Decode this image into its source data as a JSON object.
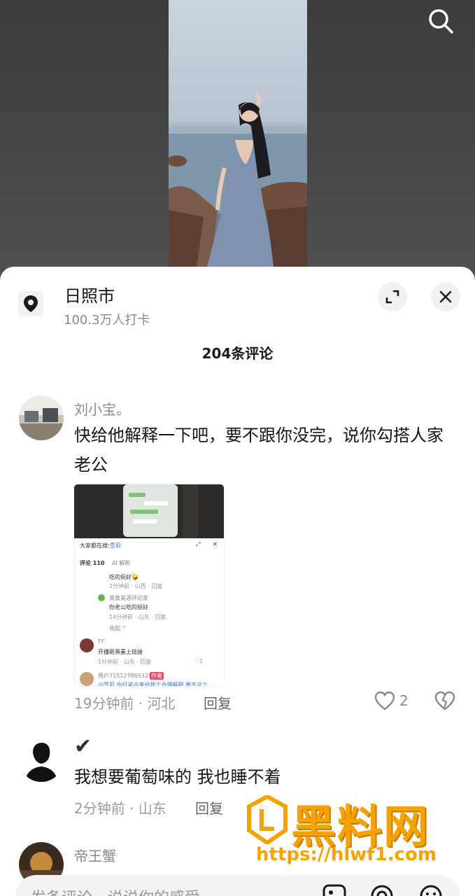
{
  "location": {
    "name": "日照市",
    "checkins": "100.3万人打卡"
  },
  "comments_header": "204条评论",
  "comments": [
    {
      "user": "刘小宝。",
      "text": "快给他解释一下吧，要不跟你没完，说你勾搭人家老公",
      "meta": "19分钟前 · 河北",
      "reply": "回复",
      "likes": "2"
    },
    {
      "user": "✔",
      "text": "我想要葡萄味的 我也睡不着",
      "meta": "2分钟前 · 山东",
      "reply": "回复"
    },
    {
      "user": "帝王蟹"
    }
  ],
  "thumbnail": {
    "search_prefix": "大家都在搜:",
    "search_term": "雪莉",
    "tab_comments": "评论 110",
    "tab_ai": "AI 解析",
    "lines": [
      {
        "text": "吃的挺好🤪",
        "meta": "2分钟前 · 山西 · 回复"
      },
      {
        "user": "美食美酒评论家",
        "text": "你老公吃的挺好",
        "meta": "14分钟前 · 山东 · 回复"
      },
      {
        "text": "收起 ^"
      },
      {
        "user": "FF",
        "text": "开播砸黑素上链接",
        "meta": "1分钟前 · 山东 · 回复",
        "likes": "1"
      },
      {
        "user": "用户7151278653292",
        "badge": "作者",
        "text": "@雪莉 你赶紧出来给我个合理解释 要不这个"
      }
    ]
  },
  "input": {
    "placeholder": "发条评论，说说你的感受"
  },
  "watermark": {
    "title": "黑料网",
    "url": "https://hlwf1.com"
  },
  "colors": {
    "accent": "#f5a300",
    "text": "#161616",
    "muted": "#8a8a8a"
  }
}
